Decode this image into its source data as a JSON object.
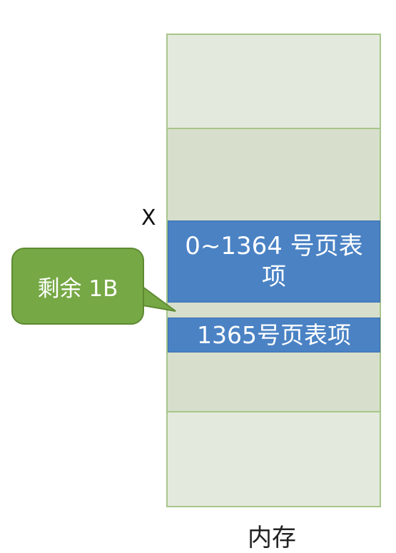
{
  "memory": {
    "caption": "内存"
  },
  "entries": {
    "range_label": "0~1364 号页表项",
    "next_label": "1365号页表项"
  },
  "address": {
    "label": "X"
  },
  "callout": {
    "text": "剩余 1B"
  },
  "colors": {
    "memory_border": "#a7c68b",
    "memory_light": "#e4e9dd",
    "memory_dark": "#d7dfcc",
    "entry_blue": "#4a82c4",
    "callout_green": "#76a845"
  }
}
